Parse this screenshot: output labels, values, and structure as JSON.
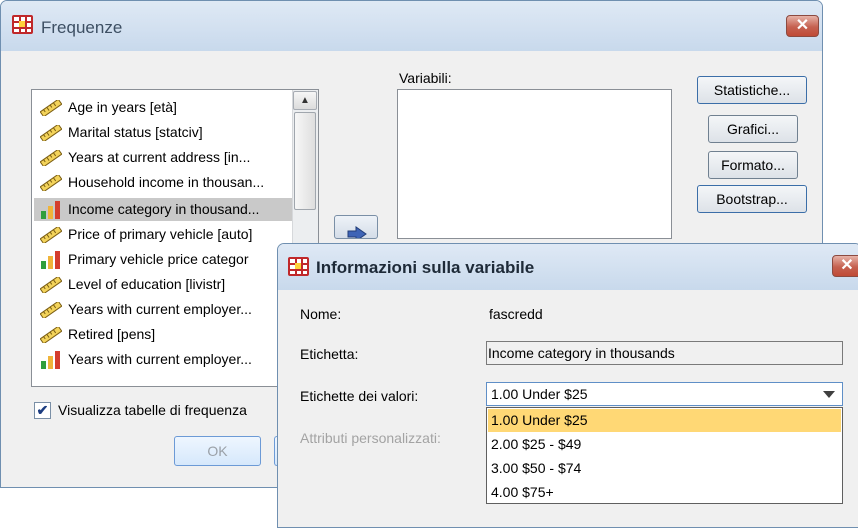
{
  "main_dialog": {
    "title": "Frequenze",
    "close_glyph": "✕",
    "source_variables": [
      {
        "label": "Age in years [età]",
        "icon": "ruler-icon"
      },
      {
        "label": "Marital status [statciv]",
        "icon": "ruler-icon"
      },
      {
        "label": "Years at current address [in...",
        "icon": "ruler-icon"
      },
      {
        "label": "Household income in thousan...",
        "icon": "ruler-icon"
      },
      {
        "label": "Income category in thousand...",
        "icon": "bar-chart-icon",
        "selected": true
      },
      {
        "label": "Price of primary vehicle [auto]",
        "icon": "ruler-icon"
      },
      {
        "label": "Primary vehicle price categor",
        "icon": "bar-chart-icon"
      },
      {
        "label": "Level of education [livistr]",
        "icon": "ruler-icon"
      },
      {
        "label": "Years with current employer...",
        "icon": "ruler-icon"
      },
      {
        "label": "Retired [pens]",
        "icon": "ruler-icon"
      },
      {
        "label": "Years with current employer...",
        "icon": "bar-chart-icon"
      }
    ],
    "variables_label": "Variabili:",
    "buttons": {
      "statistiche": "Statistiche...",
      "grafici": "Grafici...",
      "formato": "Formato...",
      "bootstrap": "Bootstrap...",
      "ok": "OK"
    },
    "checkbox": {
      "label": "Visualizza tabelle di frequenza",
      "checked": true,
      "glyph": "✔"
    }
  },
  "info_dialog": {
    "title": "Informazioni sulla variabile",
    "close_glyph": "✕",
    "nome_label": "Nome:",
    "nome_value": "fascredd",
    "etichetta_label": "Etichetta:",
    "etichetta_value": "Income category in thousands",
    "valori_label": "Etichette dei valori:",
    "valori_selected": "1.00  Under $25",
    "valori_options": [
      "1.00  Under $25",
      "2.00  $25 - $49",
      "3.00  $50 - $74",
      "4.00  $75+"
    ],
    "attributi_label": "Attributi personalizzati:"
  },
  "colors": {
    "highlight": "#ffd875",
    "title_gradient_top": "#dfe9f5",
    "close_button": "#c56150"
  }
}
